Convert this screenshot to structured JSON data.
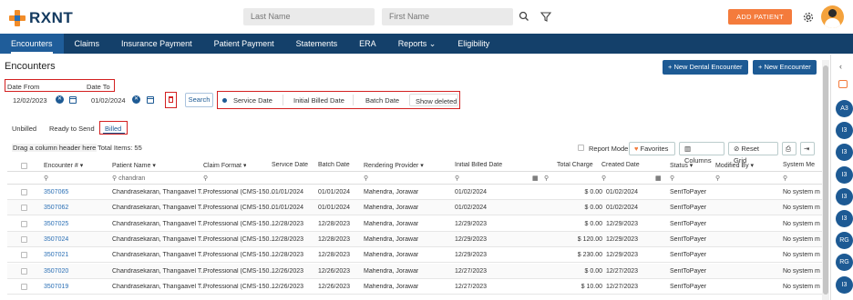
{
  "app": {
    "logo_text": "RXNT"
  },
  "topbar": {
    "last_name_placeholder": "Last Name",
    "first_name_placeholder": "First Name",
    "add_patient": "ADD PATIENT"
  },
  "nav": [
    {
      "label": "Encounters"
    },
    {
      "label": "Claims"
    },
    {
      "label": "Insurance Payment"
    },
    {
      "label": "Patient Payment"
    },
    {
      "label": "Statements"
    },
    {
      "label": "ERA"
    },
    {
      "label": "Reports ⌄"
    },
    {
      "label": "Eligibility"
    }
  ],
  "page": {
    "title": "Encounters",
    "new_dental": "+ New Dental Encounter",
    "new_encounter": "+ New Encounter"
  },
  "filters": {
    "date_from_label": "Date From",
    "date_to_label": "Date To",
    "date_from": "12/02/2023",
    "date_to": "01/02/2024",
    "search": "Search",
    "service_date": "Service Date",
    "initial_billed_date": "Initial Billed Date",
    "batch_date": "Batch Date",
    "show_deleted": "Show deleted"
  },
  "tabs": {
    "unbilled": "Unbilled",
    "ready": "Ready to Send",
    "billed": "Billed"
  },
  "grid_toolbar": {
    "drag_hint": "Drag a column header here",
    "total_items": "Total Items: 55",
    "report_mode": "Report Mode",
    "favorites": "Favorites",
    "columns": "Columns",
    "reset_grid": "Reset Grid"
  },
  "columns": [
    "Encounter #",
    "Patient Name",
    "Claim Format",
    "Service Date",
    "Batch Date",
    "Rendering Provider",
    "Initial Billed Date",
    "Total Charge",
    "Created Date",
    "Status",
    "Modified By",
    "System Me"
  ],
  "patient_filter": "chandran",
  "rows": [
    {
      "enc": "3507065",
      "patient": "Chandrasekaran, Thangaavel T...",
      "format": "Professional (CMS-150...",
      "service": "01/01/2024",
      "batch": "01/01/2024",
      "provider": "Mahendra, Jorawar",
      "billed": "01/02/2024",
      "charge": "$ 0.00",
      "created": "01/02/2024",
      "status": "SentToPayer",
      "modified": "",
      "system": "No system m"
    },
    {
      "enc": "3507062",
      "patient": "Chandrasekaran, Thangaavel T...",
      "format": "Professional (CMS-150...",
      "service": "01/01/2024",
      "batch": "01/01/2024",
      "provider": "Mahendra, Jorawar",
      "billed": "01/02/2024",
      "charge": "$ 0.00",
      "created": "01/02/2024",
      "status": "SentToPayer",
      "modified": "",
      "system": "No system m"
    },
    {
      "enc": "3507025",
      "patient": "Chandrasekaran, Thangaavel T...",
      "format": "Professional (CMS-150...",
      "service": "12/28/2023",
      "batch": "12/28/2023",
      "provider": "Mahendra, Jorawar",
      "billed": "12/29/2023",
      "charge": "$ 0.00",
      "created": "12/29/2023",
      "status": "SentToPayer",
      "modified": "",
      "system": "No system m"
    },
    {
      "enc": "3507024",
      "patient": "Chandrasekaran, Thangaavel T...",
      "format": "Professional (CMS-150...",
      "service": "12/28/2023",
      "batch": "12/28/2023",
      "provider": "Mahendra, Jorawar",
      "billed": "12/29/2023",
      "charge": "$ 120.00",
      "created": "12/29/2023",
      "status": "SentToPayer",
      "modified": "",
      "system": "No system m"
    },
    {
      "enc": "3507021",
      "patient": "Chandrasekaran, Thangaavel T...",
      "format": "Professional (CMS-150...",
      "service": "12/28/2023",
      "batch": "12/28/2023",
      "provider": "Mahendra, Jorawar",
      "billed": "12/29/2023",
      "charge": "$ 230.00",
      "created": "12/29/2023",
      "status": "SentToPayer",
      "modified": "",
      "system": "No system m"
    },
    {
      "enc": "3507020",
      "patient": "Chandrasekaran, Thangaavel T...",
      "format": "Professional (CMS-150...",
      "service": "12/26/2023",
      "batch": "12/26/2023",
      "provider": "Mahendra, Jorawar",
      "billed": "12/27/2023",
      "charge": "$ 0.00",
      "created": "12/27/2023",
      "status": "SentToPayer",
      "modified": "",
      "system": "No system m"
    },
    {
      "enc": "3507019",
      "patient": "Chandrasekaran, Thangaavel T...",
      "format": "Professional (CMS-150...",
      "service": "12/26/2023",
      "batch": "12/26/2023",
      "provider": "Mahendra, Jorawar",
      "billed": "12/27/2023",
      "charge": "$ 10.00",
      "created": "12/27/2023",
      "status": "SentToPayer",
      "modified": "",
      "system": "No system m"
    }
  ],
  "sidebar": [
    "A3",
    "I3",
    "I3",
    "I3",
    "I3",
    "I3",
    "RG",
    "RG",
    "I3"
  ]
}
